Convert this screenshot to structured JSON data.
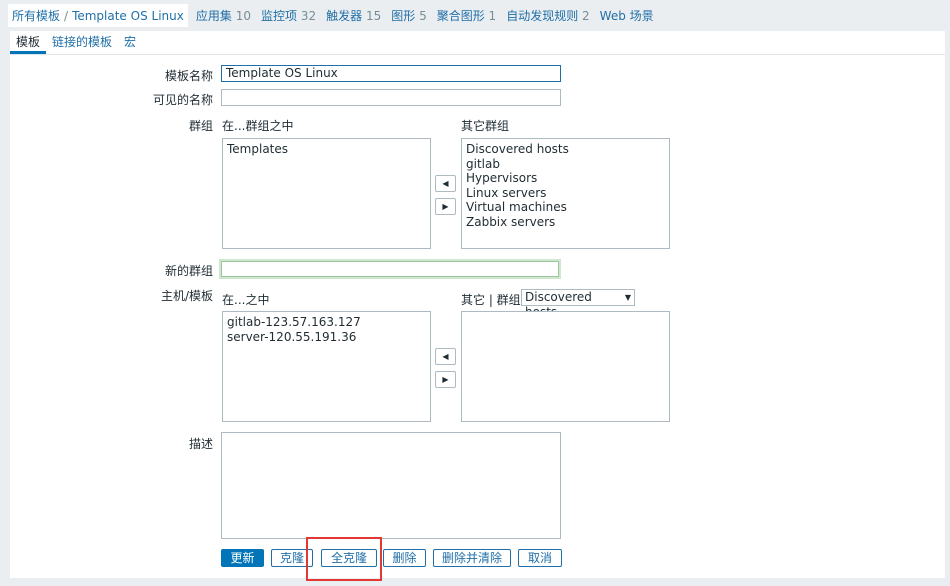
{
  "breadcrumb": {
    "all": "所有模板",
    "current": "Template OS Linux"
  },
  "nav": [
    {
      "label": "应用集",
      "count": "10"
    },
    {
      "label": "监控项",
      "count": "32"
    },
    {
      "label": "触发器",
      "count": "15"
    },
    {
      "label": "图形",
      "count": "5"
    },
    {
      "label": "聚合图形",
      "count": "1"
    },
    {
      "label": "自动发现规则",
      "count": "2"
    },
    {
      "label": "Web 场景",
      "count": ""
    }
  ],
  "tabs": [
    "模板",
    "链接的模板",
    "宏"
  ],
  "form": {
    "template_name_label": "模板名称",
    "template_name": "Template OS Linux",
    "visible_name_label": "可见的名称",
    "visible_name": "",
    "groups_label": "群组",
    "in_groups_label": "在...群组之中",
    "other_groups_label": "其它群组",
    "in_groups": [
      "Templates"
    ],
    "other_groups": [
      "Discovered hosts",
      "gitlab",
      "Hypervisors",
      "Linux servers",
      "Virtual machines",
      "Zabbix servers"
    ],
    "new_group_label": "新的群组",
    "new_group": "",
    "hosts_label": "主机/模板",
    "in_hosts_label": "在...之中",
    "other_hosts_label": "其它 | 群组",
    "group_select": "Discovered hosts",
    "in_hosts": [
      "gitlab-123.57.163.127",
      "server-120.55.191.36"
    ],
    "other_hosts": [],
    "description_label": "描述",
    "description": ""
  },
  "buttons": {
    "update": "更新",
    "clone": "克隆",
    "full_clone": "全克隆",
    "delete": "删除",
    "delete_clear": "删除并清除",
    "cancel": "取消"
  },
  "colors": {
    "accent": "#0275b8",
    "highlight": "#e33734"
  }
}
